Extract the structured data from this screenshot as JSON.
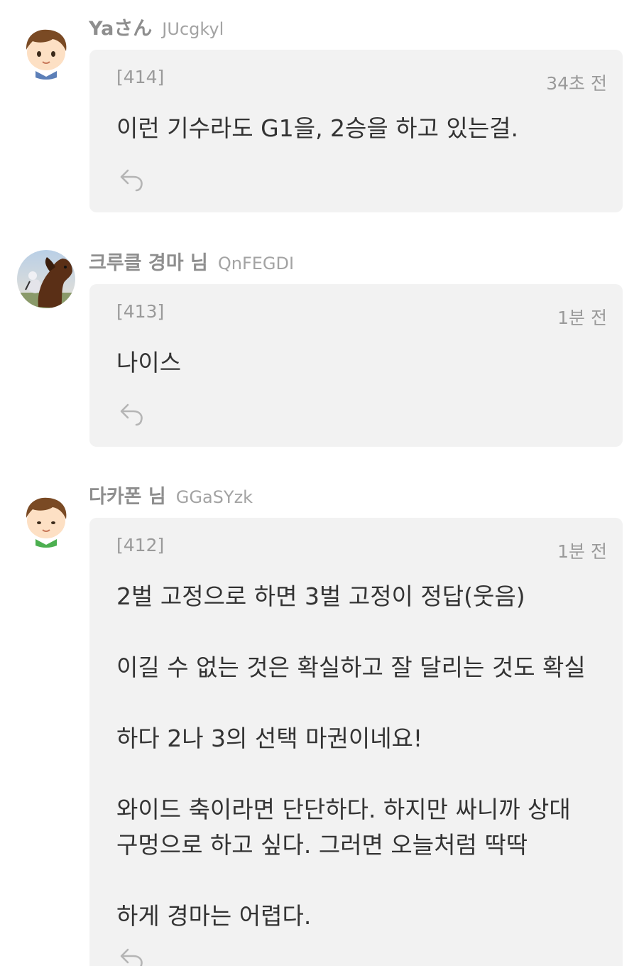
{
  "comments": [
    {
      "author": "Yaさん",
      "user_id": "JUcgkyl",
      "post_number": "[414]",
      "time": "34초 전",
      "body": "이런 기수라도 G1을, 2승을 하고 있는걸.",
      "avatar_icon": "boy-avatar-icon"
    },
    {
      "author": "크루클 경마 님",
      "user_id": "QnFEGDI",
      "post_number": "[413]",
      "time": "1분 전",
      "body": "나이스",
      "avatar_icon": "horse-photo-avatar"
    },
    {
      "author": "다카폰 님",
      "user_id": "GGaSYzk",
      "post_number": "[412]",
      "time": "1분 전",
      "body": "2벌 고정으로 하면 3벌 고정이 정답(웃음)\n\n이길 수 없는 것은 확실하고 잘 달리는 것도 확실\n\n하다 2나 3의 선택 마권이네요!\n\n와이드 축이라면 단단하다. 하지만 싸니까 상대\n구멍으로 하고 싶다. 그러면 오늘처럼 딱딱\n\n하게 경마는 어렵다.",
      "avatar_icon": "boy-avatar-icon"
    }
  ],
  "colors": {
    "bubble_bg": "#f2f2f2",
    "author": "#8e8e8e",
    "meta": "#9a9a9a",
    "body": "#333333",
    "reply_icon": "#b5b5b5"
  }
}
